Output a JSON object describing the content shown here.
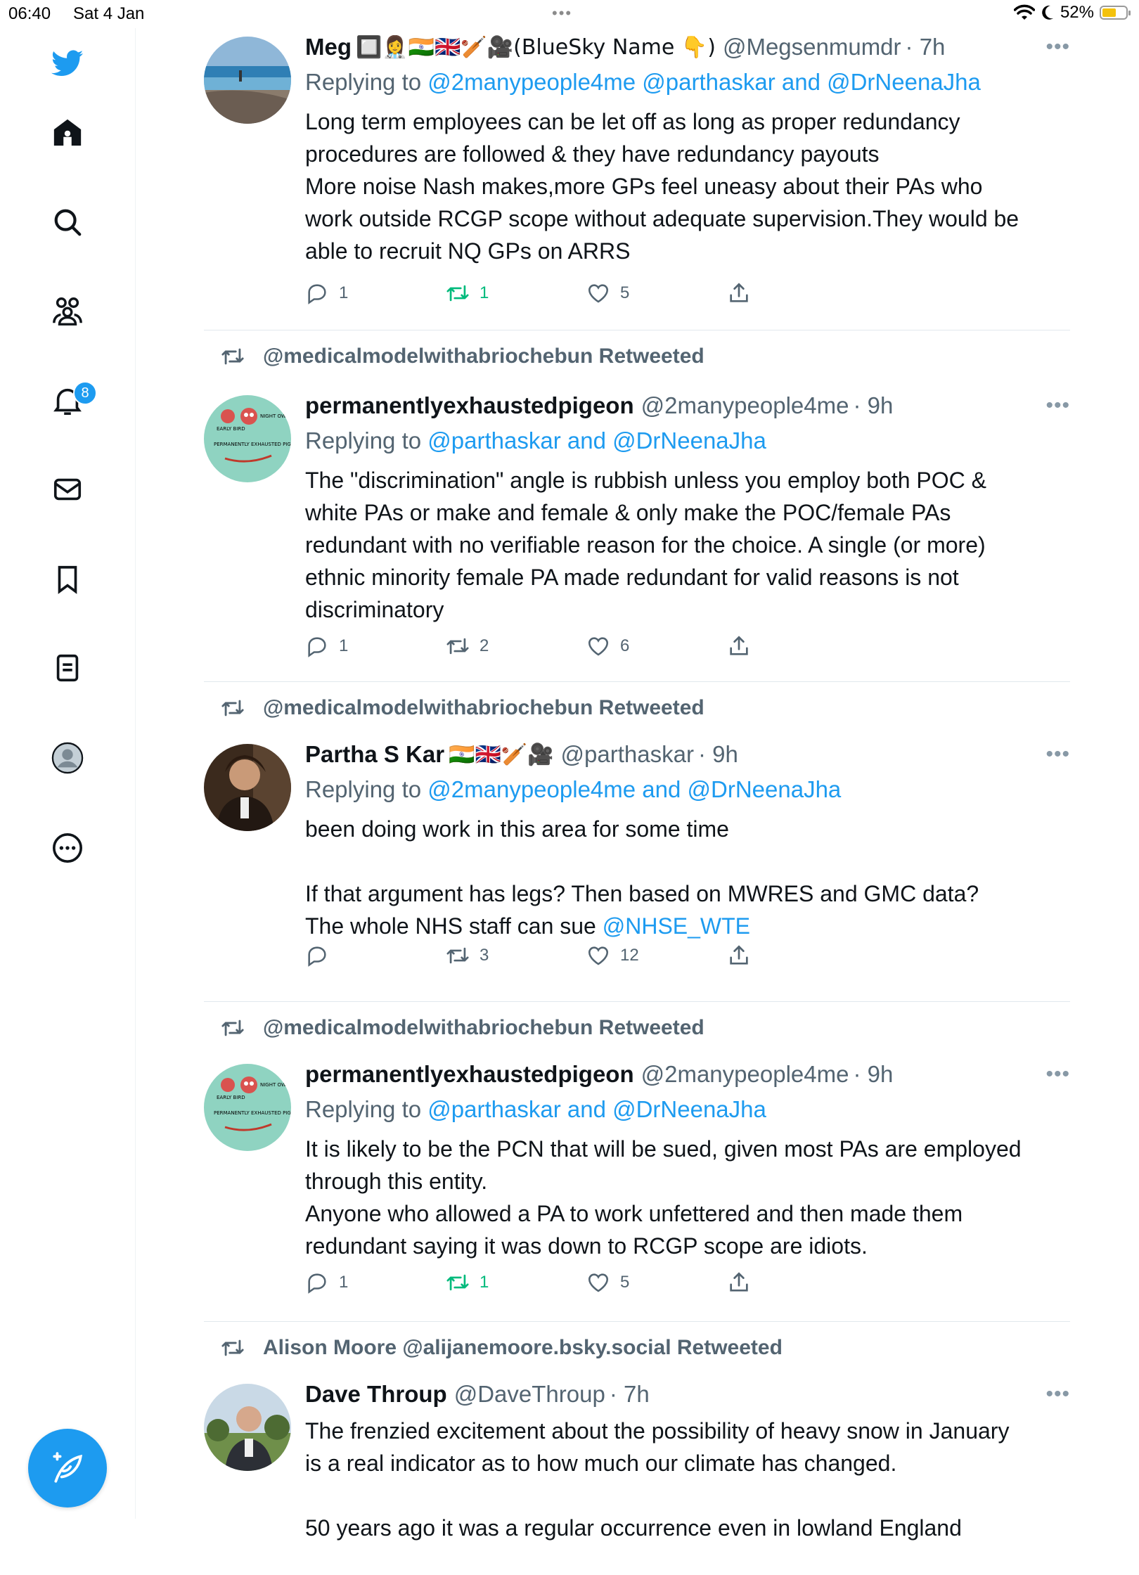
{
  "status_bar": {
    "time": "06:40",
    "date": "Sat 4 Jan",
    "dots": "•••",
    "battery": "52%"
  },
  "sidebar": {
    "notification_count": "8",
    "items": [
      "twitter-logo",
      "home",
      "explore",
      "communities",
      "notifications",
      "messages",
      "bookmarks",
      "lists",
      "profile",
      "more"
    ]
  },
  "tweets": [
    {
      "rt": "",
      "name": "Meg",
      "emojis": "🔲👩‍⚕️🇮🇳🇬🇧🏏🎥(BlueSky Name 👇)",
      "handle": "@Megsenmumdr",
      "time": "· 7h",
      "replying_prefix": "Replying to",
      "replying_to": "@2manypeople4me @parthaskar and @DrNeenaJha",
      "body": [
        "Long term employees can be let off as long as proper redundancy",
        "procedures are followed & they have redundancy payouts",
        "More noise Nash makes,more GPs feel uneasy about their PAs who",
        "work outside RCGP scope without adequate supervision.They would be",
        "able to recruit NQ GPs on ARRS"
      ],
      "replies": "1",
      "retweets": "1",
      "likes": "5",
      "retweeted": true
    },
    {
      "rt": "@medicalmodelwithabriochebun Retweeted",
      "name": "permanentlyexhaustedpigeon",
      "emojis": "",
      "handle": "@2manypeople4me",
      "time": "· 9h",
      "replying_prefix": "Replying to",
      "replying_to": "@parthaskar and @DrNeenaJha",
      "body": [
        "The \"discrimination\" angle is rubbish unless you employ both POC &",
        "white PAs or make and female & only make the POC/female PAs",
        "redundant with no verifiable reason for the choice. A single (or more)",
        "ethnic minority female PA made redundant for valid reasons  is not",
        "discriminatory"
      ],
      "replies": "1",
      "retweets": "2",
      "likes": "6",
      "retweeted": false
    },
    {
      "rt": "@medicalmodelwithabriochebun Retweeted",
      "name": "Partha S Kar",
      "emojis": "🇮🇳🇬🇧🏏🎥",
      "handle": "@parthaskar",
      "time": "· 9h",
      "replying_prefix": "Replying to",
      "replying_to": "@2manypeople4me and @DrNeenaJha",
      "body": [
        "been doing work in this area for some time",
        "",
        "If that argument has legs? Then based on MWRES and GMC data?",
        "The whole NHS staff can sue"
      ],
      "body_link": "@NHSE_WTE",
      "replies": "",
      "retweets": "3",
      "likes": "12",
      "retweeted": false
    },
    {
      "rt": "@medicalmodelwithabriochebun Retweeted",
      "name": "permanentlyexhaustedpigeon",
      "emojis": "",
      "handle": "@2manypeople4me",
      "time": "· 9h",
      "replying_prefix": "Replying to",
      "replying_to": "@parthaskar and @DrNeenaJha",
      "body": [
        "It is likely to be the PCN that will be sued, given most PAs are employed",
        "through this entity.",
        "Anyone who allowed a PA to work unfettered and then made them",
        "redundant saying it was down to RCGP scope are idiots."
      ],
      "replies": "1",
      "retweets": "1",
      "likes": "5",
      "retweeted": true
    },
    {
      "rt": "Alison Moore @alijanemoore.bsky.social Retweeted",
      "name": "Dave Throup",
      "emojis": "",
      "handle": "@DaveThroup",
      "time": "· 7h",
      "body": [
        "The frenzied excitement about the possibility of heavy snow in January",
        "is a real indicator as to how much our climate has changed.",
        "",
        "50 years ago it was a regular occurrence even in lowland England"
      ]
    }
  ],
  "colors": {
    "accent": "#1d9bf0",
    "retweet_green": "#00ba7c",
    "muted": "#536471"
  },
  "avatar_text": {
    "early_bird": "EARLY BIRD",
    "night_owl": "NIGHT OWL",
    "caption": "PERMANENTLY EXHAUSTED PIGEON"
  }
}
